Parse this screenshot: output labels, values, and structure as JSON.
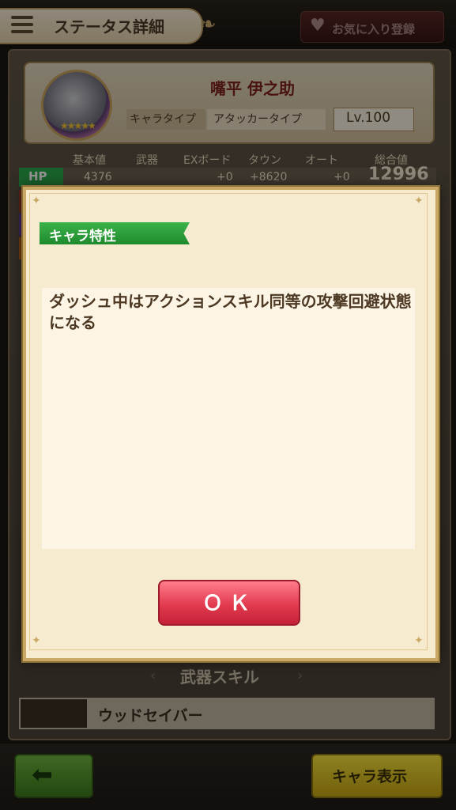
{
  "header": {
    "title": "ステータス詳細",
    "favorite_label": "お気に入り登録"
  },
  "character": {
    "name": "嘴平 伊之助",
    "type_label": "キャラタイプ",
    "type_value": "アタッカータイプ",
    "level": "Lv.100",
    "stars": "★★★★★"
  },
  "stats": {
    "columns": [
      "基本値",
      "武器",
      "EXボード",
      "タウン",
      "オート",
      "総合値"
    ],
    "hp_label": "HP",
    "hp_values": {
      "base": "4376",
      "ex": "+0",
      "town": "+8620",
      "auto": "+0",
      "total": "12996"
    }
  },
  "weapon_skill": {
    "heading": "武器スキル",
    "name": "ウッドセイバー"
  },
  "dialog": {
    "ribbon": "キャラ特性",
    "description": "ダッシュ中はアクションスキル同等の攻撃回避状態になる",
    "ok_label": "ＯＫ"
  },
  "footer": {
    "back_icon": "back-arrow-icon",
    "chara_view_label": "キャラ表示"
  },
  "colors": {
    "ok_button": "#e23a4f",
    "ribbon": "#2a9d3a",
    "chara_button": "#e2c226",
    "back_button": "#55a02e"
  }
}
